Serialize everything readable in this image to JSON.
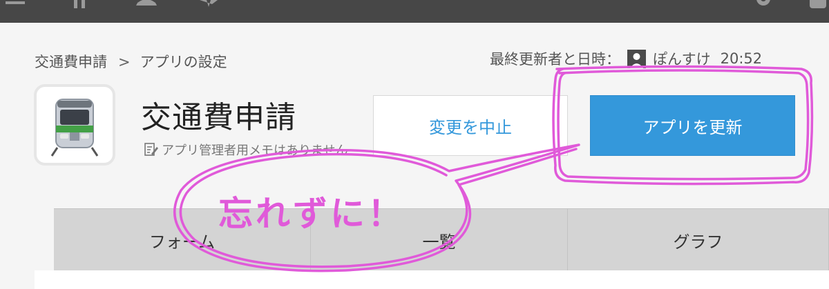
{
  "topbar": {
    "icons": [
      "menu-icon",
      "pin-icon",
      "bell-icon",
      "star-icon",
      "gear-icon"
    ]
  },
  "breadcrumb": {
    "items": [
      "交通費申請",
      "アプリの設定"
    ],
    "separator": ">"
  },
  "modified": {
    "label": "最終更新者と日時：",
    "user": "ぽんすけ",
    "time": "20:52"
  },
  "app": {
    "icon": "train-icon",
    "title": "交通費申請",
    "description": "アプリ管理者用メモはありません"
  },
  "buttons": {
    "cancel_label": "変更を中止",
    "update_label": "アプリを更新"
  },
  "tabs": [
    {
      "label": "フォーム"
    },
    {
      "label": "一覧"
    },
    {
      "label": "グラフ"
    }
  ],
  "annotation": {
    "text": "忘れずに！",
    "color": "#e05ad9"
  },
  "colors": {
    "accent": "#3498db",
    "topbar": "#474747"
  }
}
